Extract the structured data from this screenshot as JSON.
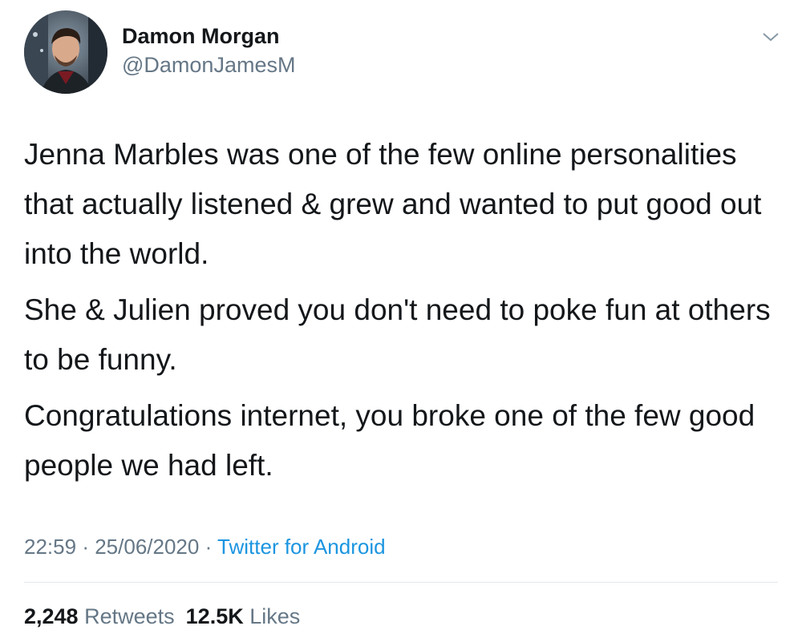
{
  "author": {
    "display_name": "Damon Morgan",
    "handle": "@DamonJamesM",
    "avatar_icon": "profile-photo"
  },
  "menu": {
    "icon": "chevron-down-icon"
  },
  "tweet": {
    "paragraphs": [
      "Jenna Marbles was one of the few online personalities that actually listened & grew and wanted to put good out into the world.",
      "She & Julien proved you don't need to poke fun at others to be funny.",
      "Congratulations internet, you broke one of the few good people we had left."
    ]
  },
  "meta": {
    "time": "22:59",
    "separator": "·",
    "date": "25/06/2020",
    "source": "Twitter for Android"
  },
  "stats": {
    "retweets_count": "2,248",
    "retweets_label": "Retweets",
    "likes_count": "12.5K",
    "likes_label": "Likes"
  },
  "colors": {
    "text": "#14171a",
    "secondary": "#657786",
    "link": "#1b95e0",
    "divider": "#e1e8ed"
  }
}
